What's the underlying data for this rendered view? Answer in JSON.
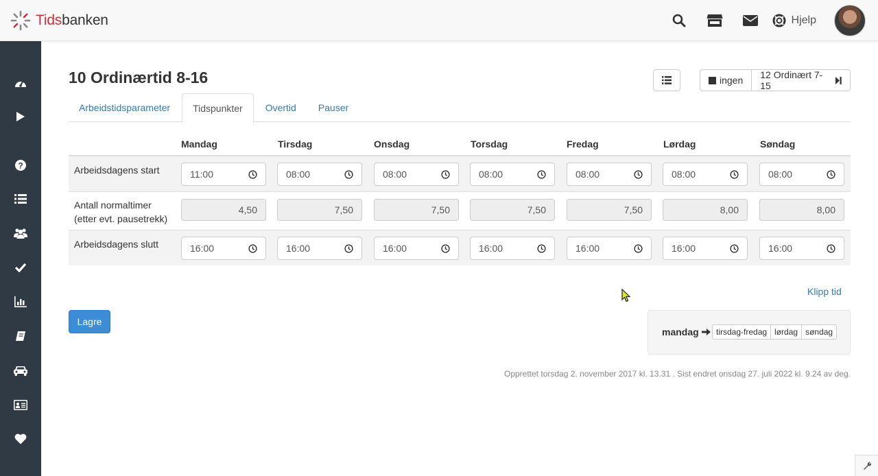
{
  "brand": {
    "name_part1": "Tids",
    "name_part2": "banken",
    "accent_color": "#c8323a"
  },
  "topbar": {
    "icons": [
      "search-icon",
      "store-icon",
      "envelope-icon",
      "lifebuoy-icon"
    ],
    "help_label": "Hjelp"
  },
  "sidebar": {
    "icons": [
      "dashboard-icon",
      "play-icon",
      "question-icon",
      "list-icon",
      "users-icon",
      "check-icon",
      "bar-chart-icon",
      "book-icon",
      "car-icon",
      "id-card-icon",
      "heart-icon"
    ]
  },
  "page": {
    "title": "10 Ordinærtid 8-16",
    "nav_none_label": "ingen",
    "nav_next_label": "12 Ordinært 7-15"
  },
  "tabs": [
    {
      "label": "Arbeidstidsparameter",
      "active": false
    },
    {
      "label": "Tidspunkter",
      "active": true
    },
    {
      "label": "Overtid",
      "active": false
    },
    {
      "label": "Pauser",
      "active": false
    }
  ],
  "schedule": {
    "days": [
      "Mandag",
      "Tirsdag",
      "Onsdag",
      "Torsdag",
      "Fredag",
      "Lørdag",
      "Søndag"
    ],
    "start_label": "Arbeidsdagens start",
    "start_times": [
      "11:00",
      "08:00",
      "08:00",
      "08:00",
      "08:00",
      "08:00",
      "08:00"
    ],
    "hours_label_1": "Antall normaltimer",
    "hours_label_2": "(etter evt. pausetrekk)",
    "hours": [
      "4,50",
      "7,50",
      "7,50",
      "7,50",
      "7,50",
      "8,00",
      "8,00"
    ],
    "end_label": "Arbeidsdagens slutt",
    "end_times": [
      "16:00",
      "16:00",
      "16:00",
      "16:00",
      "16:00",
      "16:00",
      "16:00"
    ]
  },
  "actions": {
    "klipp_label": "Klipp tid",
    "save_label": "Lagre",
    "copy_from": "mandag",
    "copy_targets": [
      "tirsdag-fredag",
      "lørdag",
      "søndag"
    ]
  },
  "meta": "Opprettet torsdag 2. november 2017 kl. 13.31 . Sist endret onsdag 27. juli 2022 kl. 9.24 av deg.",
  "colors": {
    "sidebar": "#2f3a44",
    "link": "#337ab7",
    "primary": "#3c8dd6"
  }
}
